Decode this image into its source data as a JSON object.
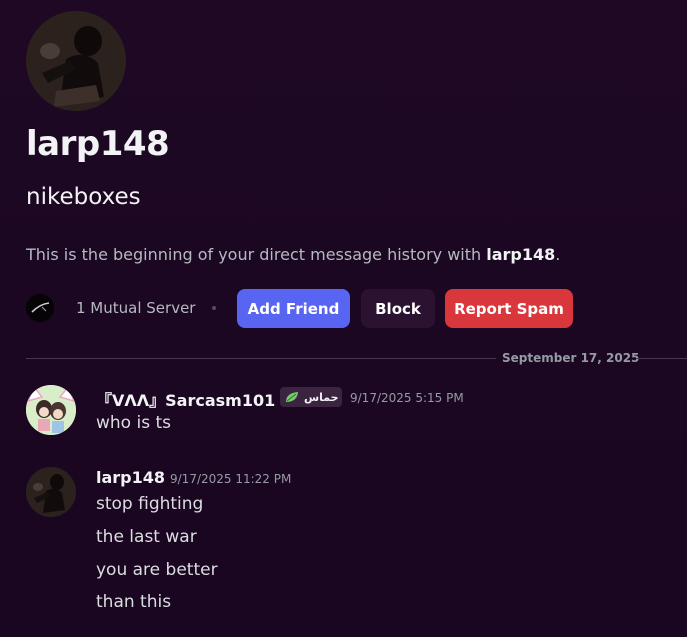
{
  "profile": {
    "username": "larp148",
    "display_name": "nikeboxes",
    "intro_prefix": "This is the beginning of your direct message history with ",
    "intro_user": "larp148",
    "intro_suffix": "."
  },
  "actions": {
    "mutual_servers": "1 Mutual Server",
    "add_friend": "Add Friend",
    "block": "Block",
    "report_spam": "Report Spam"
  },
  "divider": {
    "date": "September 17, 2025"
  },
  "messages": [
    {
      "author": "『VΛΛ』Sarcasm101",
      "tag": "حماس",
      "timestamp": "9/17/2025 5:15 PM",
      "lines": [
        "who is ts"
      ]
    },
    {
      "author": "larp148",
      "timestamp": "9/17/2025 11:22 PM",
      "lines": [
        "stop fighting",
        "the last war",
        "you are better",
        "than this"
      ]
    }
  ],
  "colors": {
    "background": "#1b0722",
    "add_friend": "#5865f2",
    "block": "#2a1230",
    "report_spam": "#da373c"
  },
  "icons": {
    "tag": "leaf-icon"
  }
}
